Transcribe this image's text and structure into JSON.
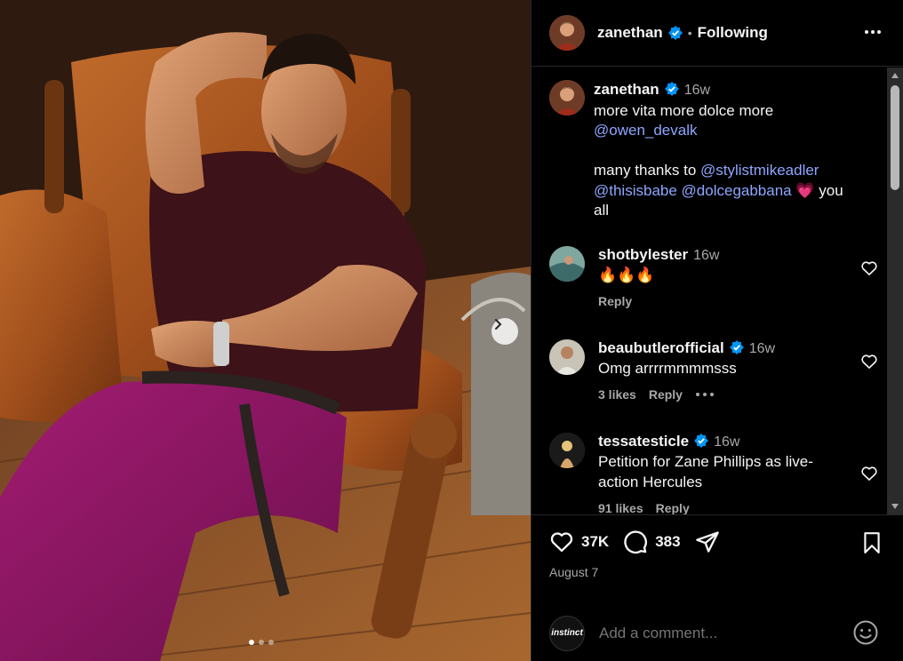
{
  "post": {
    "author": "zanethan",
    "follow_state": "Following",
    "caption_time": "16w",
    "caption_line1": "more vita more dolce more",
    "caption_mention1": "@owen_devalk",
    "caption_thanks": "many thanks to",
    "caption_mention2": "@stylistmikeadler",
    "caption_mention3": "@thisisbabe",
    "caption_mention4": "@dolcegabbana",
    "caption_emoji": "💗",
    "caption_end": "you all",
    "likes": "37K",
    "comment_count": "383",
    "date": "August 7",
    "carousel_dots": 3
  },
  "comments": [
    {
      "user": "shotbylester",
      "verified": false,
      "time": "16w",
      "text": "🔥🔥🔥",
      "likes": "",
      "reply": "Reply"
    },
    {
      "user": "beaubutlerofficial",
      "verified": true,
      "time": "16w",
      "text": "Omg arrrrmmmmsss",
      "likes": "3 likes",
      "reply": "Reply"
    },
    {
      "user": "tessatesticle",
      "verified": true,
      "time": "16w",
      "text": "Petition for Zane Phillips as live-action Hercules",
      "likes": "91 likes",
      "reply": "Reply"
    }
  ],
  "composer": {
    "placeholder": "Add a comment...",
    "avatar_label": "instinct"
  },
  "colors": {
    "link": "#8ea6ff",
    "verified": "#0095f6",
    "muted": "#a8a8a8"
  },
  "icons": [
    "more-icon",
    "verified-icon",
    "heart-icon",
    "comment-icon",
    "share-icon",
    "bookmark-icon",
    "emoji-icon",
    "chevron-right-icon"
  ]
}
